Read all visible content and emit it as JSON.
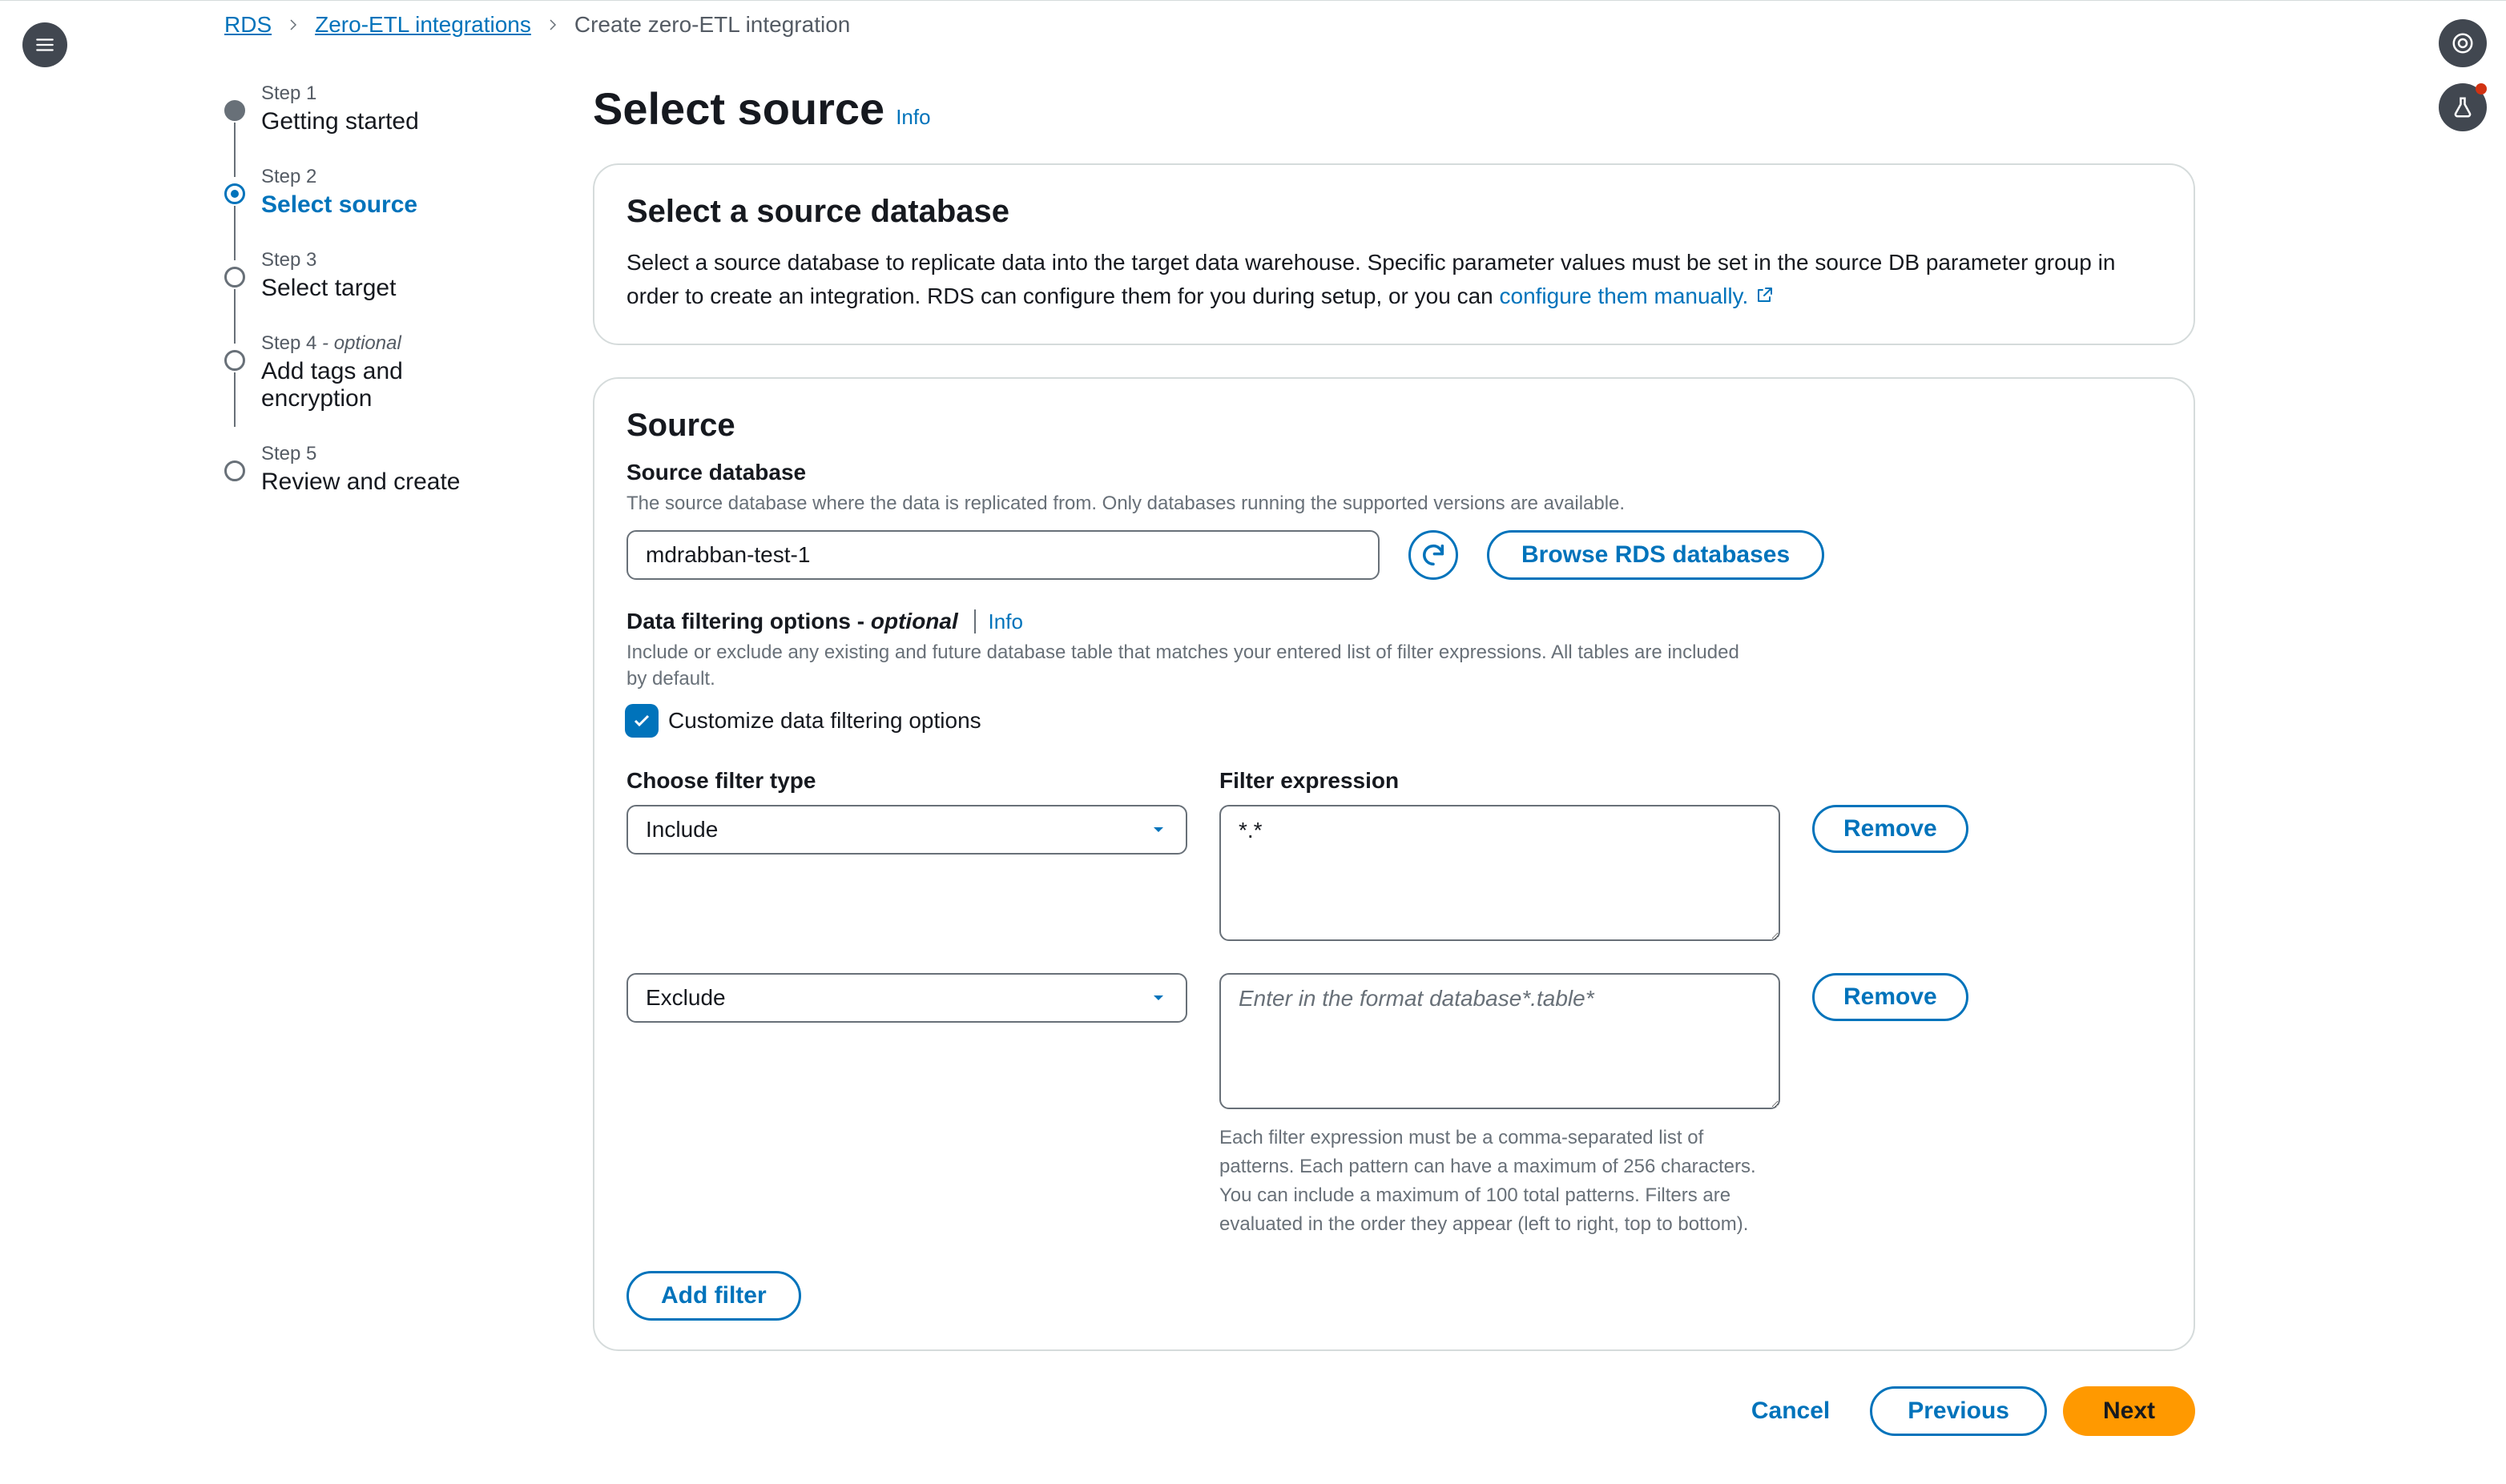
{
  "breadcrumb": {
    "items": [
      "RDS",
      "Zero-ETL integrations"
    ],
    "current": "Create zero-ETL integration"
  },
  "stepper": {
    "steps": [
      {
        "num": "Step 1",
        "label": "Getting started",
        "optional": false
      },
      {
        "num": "Step 2",
        "label": "Select source",
        "optional": false
      },
      {
        "num": "Step 3",
        "label": "Select target",
        "optional": false
      },
      {
        "num": "Step 4",
        "label": "Add tags and encryption",
        "optional": true,
        "optional_text": " - optional"
      },
      {
        "num": "Step 5",
        "label": "Review and create",
        "optional": false
      }
    ]
  },
  "page": {
    "title": "Select source",
    "info_label": "Info"
  },
  "panel_intro": {
    "title": "Select a source database",
    "desc_prefix": "Select a source database to replicate data into the target data warehouse. Specific parameter values must be set in the source DB parameter group in order to create an integration. RDS can configure them for you during setup, or you can ",
    "desc_link": "configure them manually."
  },
  "source": {
    "title": "Source",
    "db_label": "Source database",
    "db_help": "The source database where the data is replicated from. Only databases running the supported versions are available.",
    "db_value": "mdrabban-test-1",
    "browse_label": "Browse RDS databases",
    "filter_header_prefix": "Data filtering options - ",
    "filter_header_optional": "optional",
    "filter_info_label": "Info",
    "filter_help": "Include or exclude any existing and future database table that matches your entered list of filter expressions. All tables are included by default.",
    "customize_label": "Customize data filtering options",
    "col_type": "Choose filter type",
    "col_expr": "Filter expression",
    "filters": [
      {
        "type": "Include",
        "expression": "*.*",
        "placeholder": ""
      },
      {
        "type": "Exclude",
        "expression": "",
        "placeholder": "Enter in the format database*.table*"
      }
    ],
    "remove_label": "Remove",
    "expr_hint": "Each filter expression must be a comma-separated list of patterns. Each pattern can have a maximum of 256 characters. You can include a maximum of 100 total patterns. Filters are evaluated in the order they appear (left to right, top to bottom).",
    "add_filter_label": "Add filter"
  },
  "footer": {
    "cancel": "Cancel",
    "previous": "Previous",
    "next": "Next"
  }
}
